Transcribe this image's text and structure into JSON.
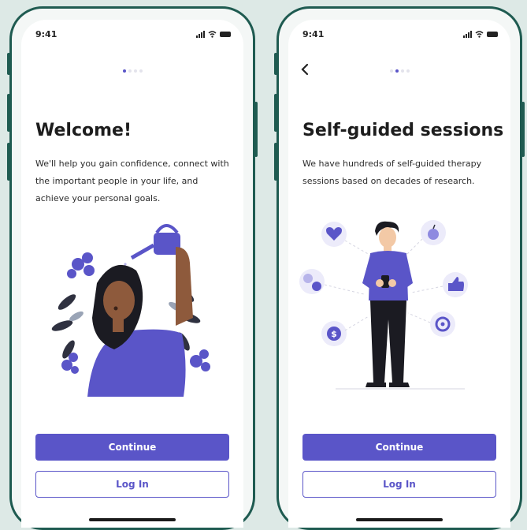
{
  "status_time": "9:41",
  "screens": [
    {
      "title": "Welcome!",
      "description": "We'll help you gain confidence, connect with the important people in your life, and achieve your personal goals.",
      "primary_button": "Continue",
      "secondary_button": "Log In",
      "active_dot": 1
    },
    {
      "title": "Self-guided sessions",
      "description": "We have hundreds of self-guided therapy sessions based on decades of research.",
      "primary_button": "Continue",
      "secondary_button": "Log In",
      "active_dot": 2
    }
  ],
  "colors": {
    "accent": "#5a55c8",
    "frame": "#1f5b51",
    "background": "#dde9e6"
  },
  "icons": [
    "back-chevron-icon",
    "signal-icon",
    "wifi-icon",
    "battery-icon",
    "heart-icon",
    "apple-icon",
    "thumbs-up-icon",
    "target-icon",
    "dollar-icon",
    "emoji-icon"
  ]
}
